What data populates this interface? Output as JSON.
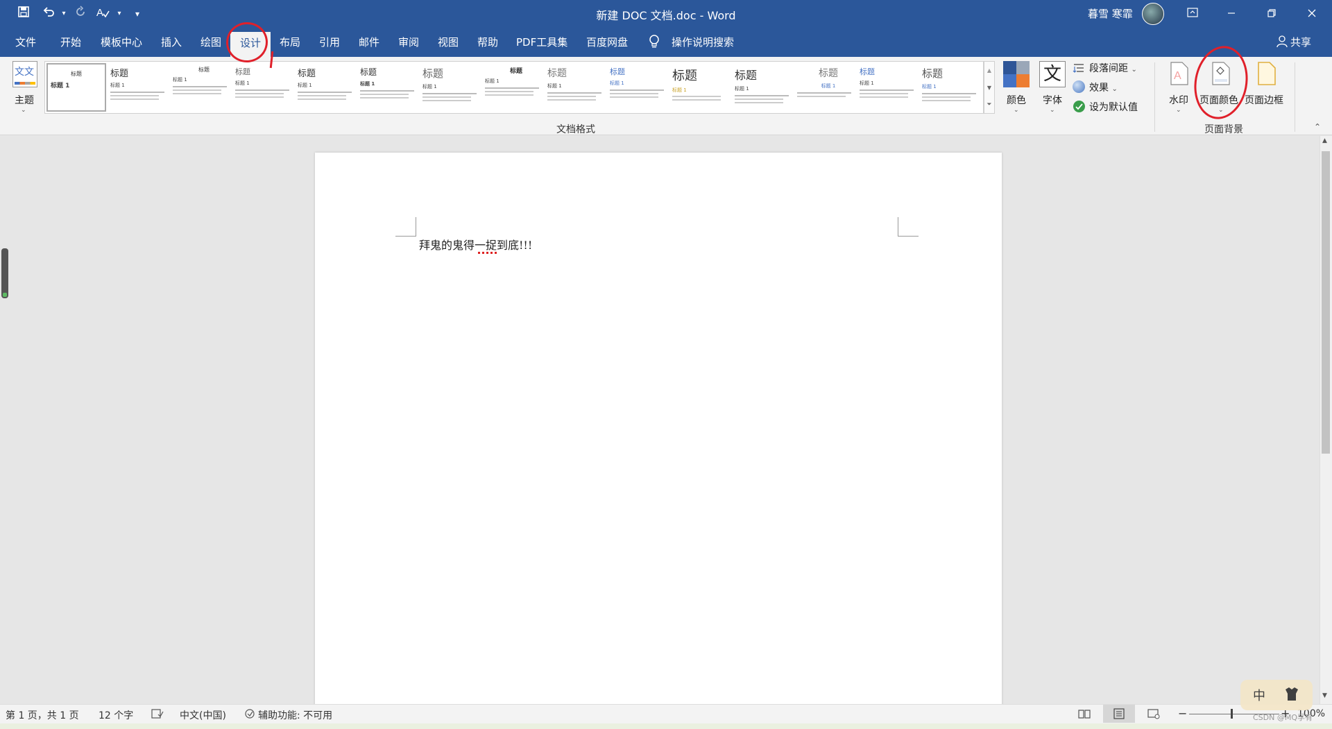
{
  "titlebar": {
    "doc_title": "新建 DOC 文档.doc  -  Word",
    "user_name": "暮雪 寒霏",
    "qat_save_icon": "save-icon",
    "qat_undo_icon": "undo-icon",
    "qat_redo_icon": "redo-icon",
    "qat_spell_icon": "spell-check-icon"
  },
  "tabs": {
    "file": "文件",
    "home": "开始",
    "templates": "模板中心",
    "insert": "插入",
    "draw": "绘图",
    "design": "设计",
    "layout": "布局",
    "references": "引用",
    "mailings": "邮件",
    "review": "审阅",
    "view": "视图",
    "help": "帮助",
    "pdf": "PDF工具集",
    "baidu": "百度网盘",
    "search": "操作说明搜索",
    "share": "共享"
  },
  "ribbon": {
    "theme_label": "主题",
    "theme_icon_text": "文文",
    "styles": [
      {
        "heading": "标题",
        "sub": "标题 1"
      },
      {
        "heading": "标题",
        "sub": "标题 1"
      },
      {
        "heading": "标题",
        "sub": "标题 1"
      },
      {
        "heading": "标题",
        "sub": "标题 1"
      },
      {
        "heading": "标题",
        "sub": "标题 1"
      },
      {
        "heading": "标题",
        "sub": "标题 1"
      },
      {
        "heading": "标题",
        "sub": "标题 1"
      },
      {
        "heading": "标题",
        "sub": "标题 1"
      },
      {
        "heading": "标题",
        "sub": "标题 1"
      },
      {
        "heading": "标题",
        "sub": "标题 1"
      },
      {
        "heading": "标题",
        "sub": "标题 1"
      },
      {
        "heading": "标题",
        "sub": "标题 1"
      },
      {
        "heading": "标题",
        "sub": "标题 1"
      },
      {
        "heading": "标题",
        "sub": "标题 1"
      },
      {
        "heading": "标题",
        "sub": "标题 1"
      }
    ],
    "doc_format_group": "文档格式",
    "colors_label": "颜色",
    "fonts_label": "字体",
    "fonts_icon_text": "文",
    "para_spacing": "段落间距",
    "effects": "效果",
    "set_default": "设为默认值",
    "watermark": "水印",
    "page_color": "页面颜色",
    "page_borders": "页面边框",
    "page_background_group": "页面背景"
  },
  "document": {
    "text": "拜鬼的鬼得一捉到底!!!"
  },
  "statusbar": {
    "page": "第 1 页，共 1 页",
    "words": "12 个字",
    "language": "中文(中国)",
    "accessibility": "辅助功能: 不可用",
    "zoom": "100%",
    "ime": "中",
    "watermark_text": "CSDN @MQ孚有"
  },
  "colors": {
    "brand": "#2b579a",
    "annotation": "#e0202a"
  }
}
